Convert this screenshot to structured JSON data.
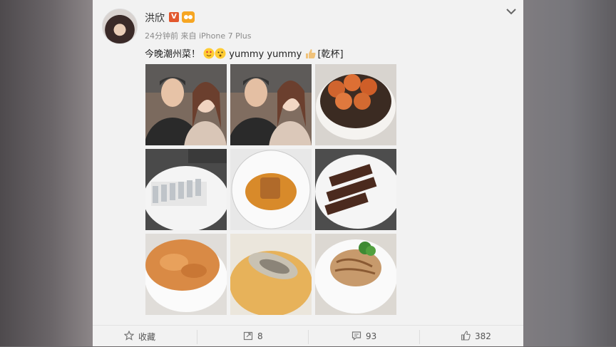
{
  "post": {
    "username": "洪欣",
    "verified_badge": "V",
    "meta": "24分钟前 来自 iPhone 7 Plus",
    "text_part1": "今晚潮州菜！",
    "text_part2": "yummy yummy",
    "text_part3": "[乾杯]",
    "emoji_names": [
      "heart-eyes-emoji",
      "surprised-emoji",
      "thumbs-up-emoji"
    ]
  },
  "actions": {
    "collect": "收藏",
    "repost": "8",
    "comment": "93",
    "like": "382"
  },
  "photos": [
    {
      "name": "selfie-couple-photo-1"
    },
    {
      "name": "selfie-couple-photo-2"
    },
    {
      "name": "fried-prawns-photo"
    },
    {
      "name": "sliced-fish-photo"
    },
    {
      "name": "braised-dish-photo"
    },
    {
      "name": "braised-goose-photo"
    },
    {
      "name": "fried-omelette-photo"
    },
    {
      "name": "oyster-soup-photo"
    },
    {
      "name": "noodle-dish-photo"
    }
  ],
  "colors": {
    "card": "#f2f2f2",
    "vbadge": "#e2572d",
    "text": "#222222",
    "meta": "#8a8a8a"
  }
}
